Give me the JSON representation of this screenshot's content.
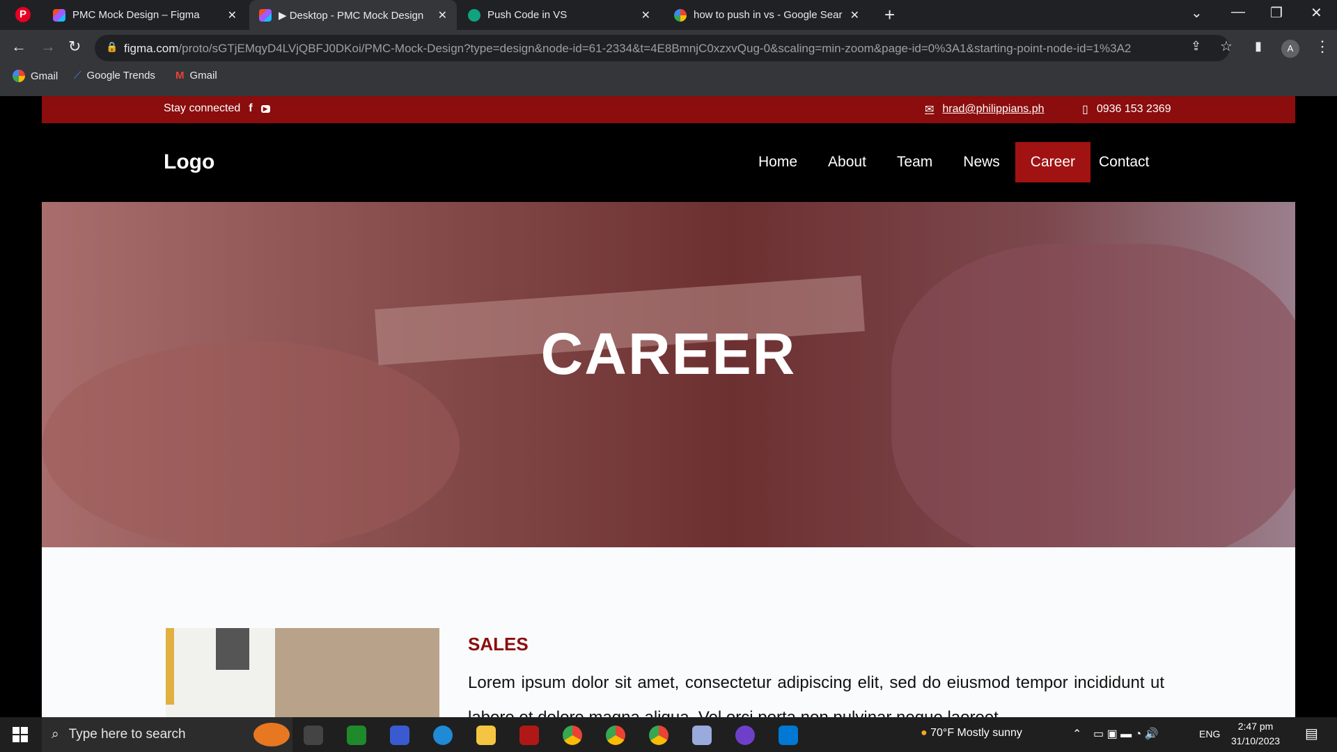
{
  "browser": {
    "tabs": [
      {
        "title": "PMC Mock Design – Figma",
        "icon": "figma-icon"
      },
      {
        "title": "▶ Desktop - PMC Mock Design",
        "icon": "figma-icon"
      },
      {
        "title": "Push Code in VS",
        "icon": "chatgpt-icon"
      },
      {
        "title": "how to push in vs - Google Sear",
        "icon": "google-icon"
      }
    ],
    "url_host": "figma.com",
    "url_path": "/proto/sGTjEMqyD4LVjQBFJ0DKoi/PMC-Mock-Design?type=design&node-id=61-2334&t=4E8BmnjC0xzxvQug-0&scaling=min-zoom&page-id=0%3A1&starting-point-node-id=1%3A2",
    "bookmarks": [
      "Gmail",
      "Google Trends",
      "Gmail"
    ],
    "profile_initial": "A"
  },
  "site": {
    "topbar": {
      "stay_connected": "Stay connected",
      "email": "hrad@philippians.ph",
      "phone": "0936 153 2369"
    },
    "logo": "Logo",
    "menu": [
      "Home",
      "About",
      "Team",
      "News",
      "Career",
      "Contact"
    ],
    "active_menu": "Career",
    "hero_title": "CAREER",
    "section_title": "SALES",
    "paragraph": "Lorem ipsum dolor sit amet, consectetur adipiscing elit, sed do eiusmod tempor incididunt ut labore et dolore magna aliqua. Vel orci porta non pulvinar neque laoreet."
  },
  "taskbar": {
    "search_placeholder": "Type here to search",
    "weather": "70°F  Mostly sunny",
    "language": "ENG",
    "time": "2:47 pm",
    "date": "31/10/2023"
  },
  "colors": {
    "brand_red": "#8b0d0d",
    "active_nav": "#a11212"
  }
}
